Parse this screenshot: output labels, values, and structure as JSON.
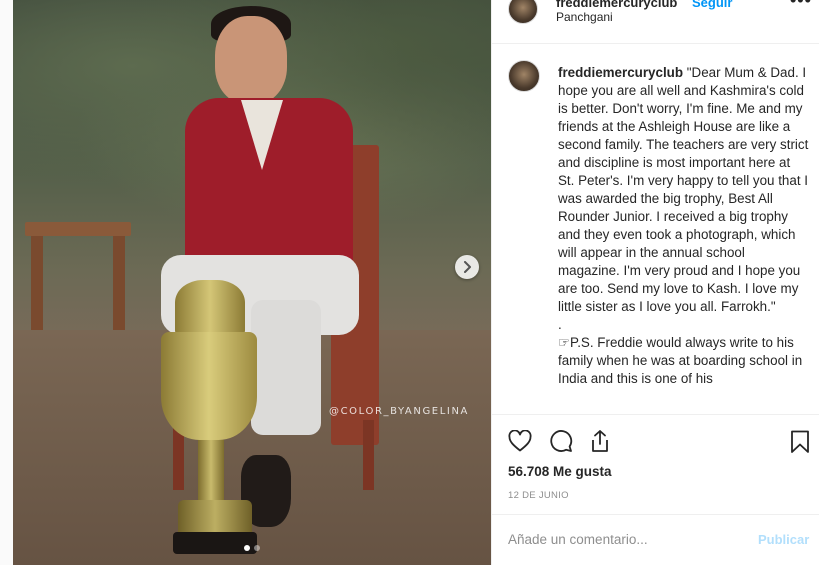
{
  "post": {
    "username": "freddiemercuryclub",
    "follow_label": "Seguir",
    "location": "Panchgani",
    "more_label": "•••",
    "watermark": "@COLOR_BYANGELINA",
    "caption": {
      "username": "freddiemercuryclub",
      "text": "\"Dear Mum & Dad. I hope you are all well and Kashmira's cold is better. Don't worry, I'm fine. Me and my friends at the Ashleigh House are like a second family. The teachers are very strict and discipline is most important here at St. Peter's. I'm very happy to tell you that I was awarded the big trophy, Best All Rounder Junior. I received a big trophy and they even took a photograph, which will appear in the annual school magazine. I'm very proud and I hope you are too. Send my love to Kash. I love my little sister as I love you all. Farrokh.\"",
      "separator": ".",
      "ps": "☞P.S. Freddie would always write to his family when he was at boarding school in India and this is one of his"
    },
    "likes": "56.708 Me gusta",
    "date": "12 DE JUNIO",
    "comment_placeholder": "Añade un comentario...",
    "publish_label": "Publicar"
  },
  "icons": {
    "like": "heart-icon",
    "comment": "comment-icon",
    "share": "share-icon",
    "save": "bookmark-icon",
    "next": "chevron-right-icon"
  },
  "colors": {
    "accent": "#0095f6",
    "publish_disabled": "#b2dffc",
    "secondary_text": "#8e8e8e"
  }
}
